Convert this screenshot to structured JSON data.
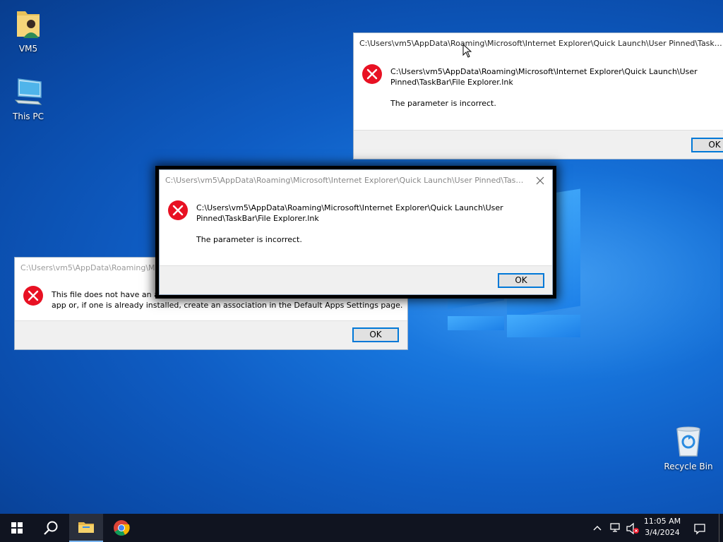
{
  "desktop": {
    "icons": [
      {
        "label": "VM5"
      },
      {
        "label": "This PC"
      },
      {
        "label": "Recycle Bin"
      }
    ]
  },
  "dialog_back_right": {
    "title": "C:\\Users\\vm5\\AppData\\Roaming\\Microsoft\\Internet Explorer\\Quick Launch\\User Pinned\\TaskB...",
    "path_line1": "C:\\Users\\vm5\\AppData\\Roaming\\Microsoft\\Internet Explorer\\Quick Launch\\User",
    "path_line2": "Pinned\\TaskBar\\File Explorer.lnk",
    "message": "The parameter is incorrect.",
    "ok_label": "OK"
  },
  "dialog_front": {
    "title": "C:\\Users\\vm5\\AppData\\Roaming\\Microsoft\\Internet Explorer\\Quick Launch\\User Pinned\\TaskB...",
    "path_line1": "C:\\Users\\vm5\\AppData\\Roaming\\Microsoft\\Internet Explorer\\Quick Launch\\User",
    "path_line2": "Pinned\\TaskBar\\File Explorer.lnk",
    "message": "The parameter is incorrect.",
    "ok_label": "OK"
  },
  "dialog_back_left": {
    "title": "C:\\Users\\vm5\\AppData\\Roaming\\M",
    "line1": "This file does not have an ap",
    "line2": "app or, if one is already installed, create an association in the Default Apps Settings page.",
    "ok_label": "OK"
  },
  "taskbar": {
    "pinned": [
      {
        "icon": "windows-start-icon"
      },
      {
        "icon": "search-icon"
      },
      {
        "icon": "file-explorer-icon"
      },
      {
        "icon": "chrome-icon"
      }
    ],
    "tray": {
      "time": "11:05 AM",
      "date": "3/4/2024"
    }
  },
  "colors": {
    "desktop_blue": "#0f5dc4",
    "taskbar": "#101420",
    "error_red": "#e81123",
    "accent": "#0078d7"
  }
}
